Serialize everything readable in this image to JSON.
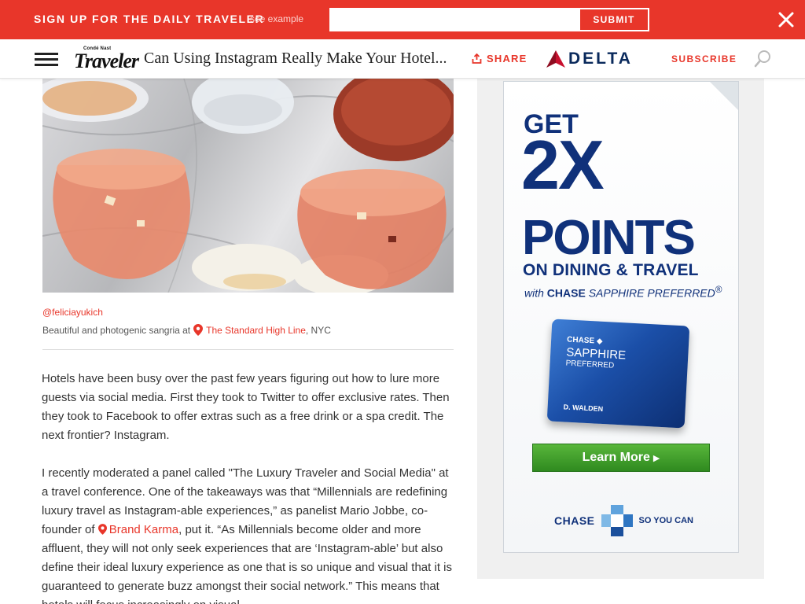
{
  "signup": {
    "title": "SIGN UP FOR THE DAILY TRAVELER",
    "example_link": "see example",
    "email_placeholder": "",
    "submit_label": "SUBMIT"
  },
  "nav": {
    "logo_small": "Condé Nast",
    "logo_main": "Traveler",
    "article_title": "Can Using Instagram Really Make Your Hotel...",
    "share_label": "SHARE",
    "sponsor": "DELTA",
    "subscribe_label": "SUBSCRIBE"
  },
  "article": {
    "caption_credit": "@feliciayukich",
    "caption_prefix": "Beautiful and photogenic sangria at",
    "caption_place": "The Standard High Line",
    "caption_suffix": ", NYC",
    "para1": "Hotels have been busy over the past few years figuring out how to lure more guests via social media. First they took to Twitter to offer exclusive rates. Then they took to Facebook to offer extras such as a free drink or a spa credit. The next frontier? Instagram.",
    "para2_before": "I recently moderated a panel called \"The Luxury Traveler and Social Media\" at a travel conference. One of the takeaways was that “Millennials are redefining luxury travel as Instagram-able experiences,” as panelist Mario Jobbe, co-founder of",
    "para2_link": "Brand Karma",
    "para2_after": ", put it. “As Millennials become older and more affluent, they will not only seek experiences that are ‘Instagram-able’ but also define their ideal luxury experience as one that is so unique and visual that it is guaranteed to generate buzz amongst their social network.” This means that hotels will focus increasingly on visual"
  },
  "ad": {
    "get": "GET",
    "headline": "2X",
    "points": "POINTS",
    "subhead": "ON DINING & TRAVEL",
    "with_prefix": "with",
    "with_brand": "CHASE",
    "with_product": "SAPPHIRE",
    "with_tier": "PREFERRED",
    "with_mark": "®",
    "card_brand": "CHASE ◆",
    "card_name": "SAPPHIRE",
    "card_tier": "PREFERRED",
    "card_holder": "D. WALDEN",
    "cta": "Learn More",
    "footer_brand": "CHASE",
    "footer_tagline": "SO YOU CAN"
  },
  "colors": {
    "brand_red": "#e8362a",
    "delta_navy": "#0a2a5c",
    "chase_blue": "#10317a",
    "cta_green": "#3f9d2a"
  },
  "icons": [
    "close-icon",
    "menu-icon",
    "share-icon",
    "delta-widget-icon",
    "search-icon",
    "location-pin-icon",
    "chase-octagon-icon"
  ]
}
